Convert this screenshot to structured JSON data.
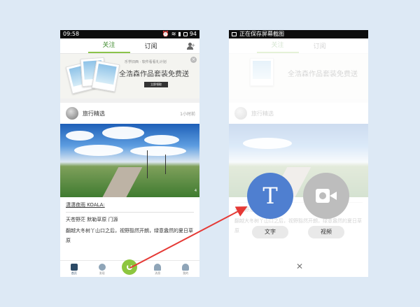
{
  "left_phone": {
    "status": {
      "time": "09:58",
      "battery": "94"
    },
    "tabs": [
      "关注",
      "订阅"
    ],
    "banner": {
      "small_text": "乐学旧西 · 软件看看礼计划",
      "headline": "全浩森作品套装免费送",
      "button": "立即领取"
    },
    "post": {
      "account": "旅行精选",
      "time": "1小时前",
      "photo_badge": "4"
    },
    "article": {
      "author": "潇潇夜雨 KOALA:",
      "headline": "天苍野茫 默勒草原 门源",
      "body": "翻越大冬树丫山口之后，视野豁然开朗，绿意盎然的夏日草原"
    },
    "nav": [
      "首页",
      "发现",
      "",
      "消息",
      "我的"
    ]
  },
  "right_phone": {
    "status": {
      "saving": "正在保存屏幕截图"
    },
    "actions": [
      {
        "glyph": "T",
        "label": "文字",
        "color": "#4f7fd0"
      },
      {
        "glyph": "video-camera-icon",
        "label": "视频",
        "color": "#bdbdbd"
      }
    ],
    "close_glyph": "✕"
  },
  "colors": {
    "accent": "#8dc63f",
    "arrow": "#e53935"
  }
}
